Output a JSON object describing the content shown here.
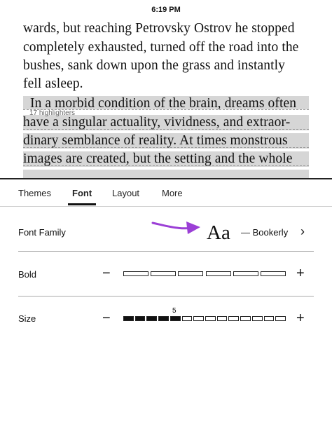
{
  "status_bar": {
    "time": "6:19 PM"
  },
  "book": {
    "lines": [
      "wards, but reaching Petrovsky Ostrov he stopped",
      "completely exhausted, turned off the road into the",
      "bushes, sank down upon the grass and instantly",
      "fell asleep.",
      "In a morbid condition of the brain, dreams often",
      "have a singular actuality, vividness, and extraor-",
      "dinary semblance of reality. At times monstrous",
      "images are created, but the setting and the whole"
    ],
    "popular_highlight": "17 highlighters"
  },
  "tabs": [
    {
      "label": "Themes",
      "active": false
    },
    {
      "label": "Font",
      "active": true
    },
    {
      "label": "Layout",
      "active": false
    },
    {
      "label": "More",
      "active": false
    }
  ],
  "font_family": {
    "label": "Font Family",
    "sample": "Aa",
    "name": "— Bookerly",
    "chevron": "›"
  },
  "bold": {
    "label": "Bold",
    "minus": "−",
    "plus": "+",
    "level": 0,
    "steps": 6
  },
  "size": {
    "label": "Size",
    "minus": "−",
    "plus": "+",
    "value": "5",
    "level": 5,
    "steps": 14
  },
  "colors": {
    "accent_arrow": "#9b3fd6",
    "highlight": "#d6d6d6",
    "ink": "#111111"
  }
}
